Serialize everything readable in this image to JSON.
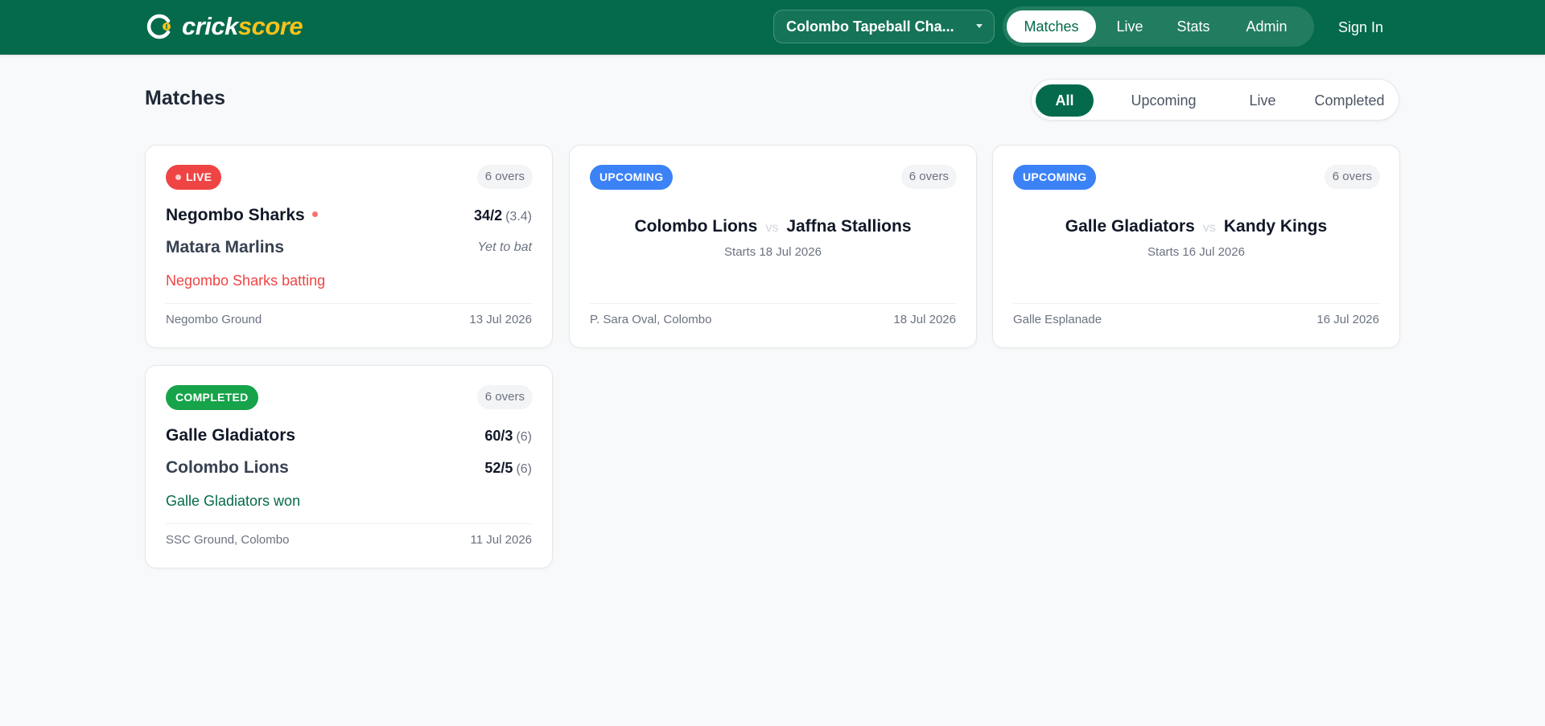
{
  "header": {
    "logo_part1": "crick",
    "logo_part2": "score",
    "tournament_select": "Colombo Tapeball Cha...",
    "nav": [
      "Matches",
      "Live",
      "Stats",
      "Admin"
    ],
    "active_nav": "Matches",
    "sign_in": "Sign In",
    "colors": {
      "brand_green": "#046a4b",
      "brand_yellow": "#f7c21b"
    }
  },
  "page": {
    "title": "Matches",
    "filters": [
      "All",
      "Upcoming",
      "Live",
      "Completed"
    ],
    "active_filter": "All"
  },
  "matches": [
    {
      "status": "LIVE",
      "overs": "6 overs",
      "team1": {
        "name": "Negombo Sharks",
        "score": "34/2",
        "overs": "(3.4)"
      },
      "team2": {
        "name": "Matara Marlins",
        "note": "Yet to bat"
      },
      "summary": "Negombo Sharks batting",
      "venue": "Negombo Ground",
      "date": "13 Jul 2026"
    },
    {
      "status": "UPCOMING",
      "overs": "6 overs",
      "team1": {
        "name": "Colombo Lions"
      },
      "team2": {
        "name": "Jaffna Stallions"
      },
      "vs": "vs",
      "starts": "Starts 18 Jul 2026",
      "venue": "P. Sara Oval, Colombo",
      "date": "18 Jul 2026"
    },
    {
      "status": "UPCOMING",
      "overs": "6 overs",
      "team1": {
        "name": "Galle Gladiators"
      },
      "team2": {
        "name": "Kandy Kings"
      },
      "vs": "vs",
      "starts": "Starts 16 Jul 2026",
      "venue": "Galle Esplanade",
      "date": "16 Jul 2026"
    },
    {
      "status": "COMPLETED",
      "overs": "6 overs",
      "team1": {
        "name": "Galle Gladiators",
        "score": "60/3",
        "overs": "(6)"
      },
      "team2": {
        "name": "Colombo Lions",
        "score": "52/5",
        "overs": "(6)"
      },
      "summary": "Galle Gladiators won",
      "venue": "SSC Ground, Colombo",
      "date": "11 Jul 2026"
    }
  ]
}
